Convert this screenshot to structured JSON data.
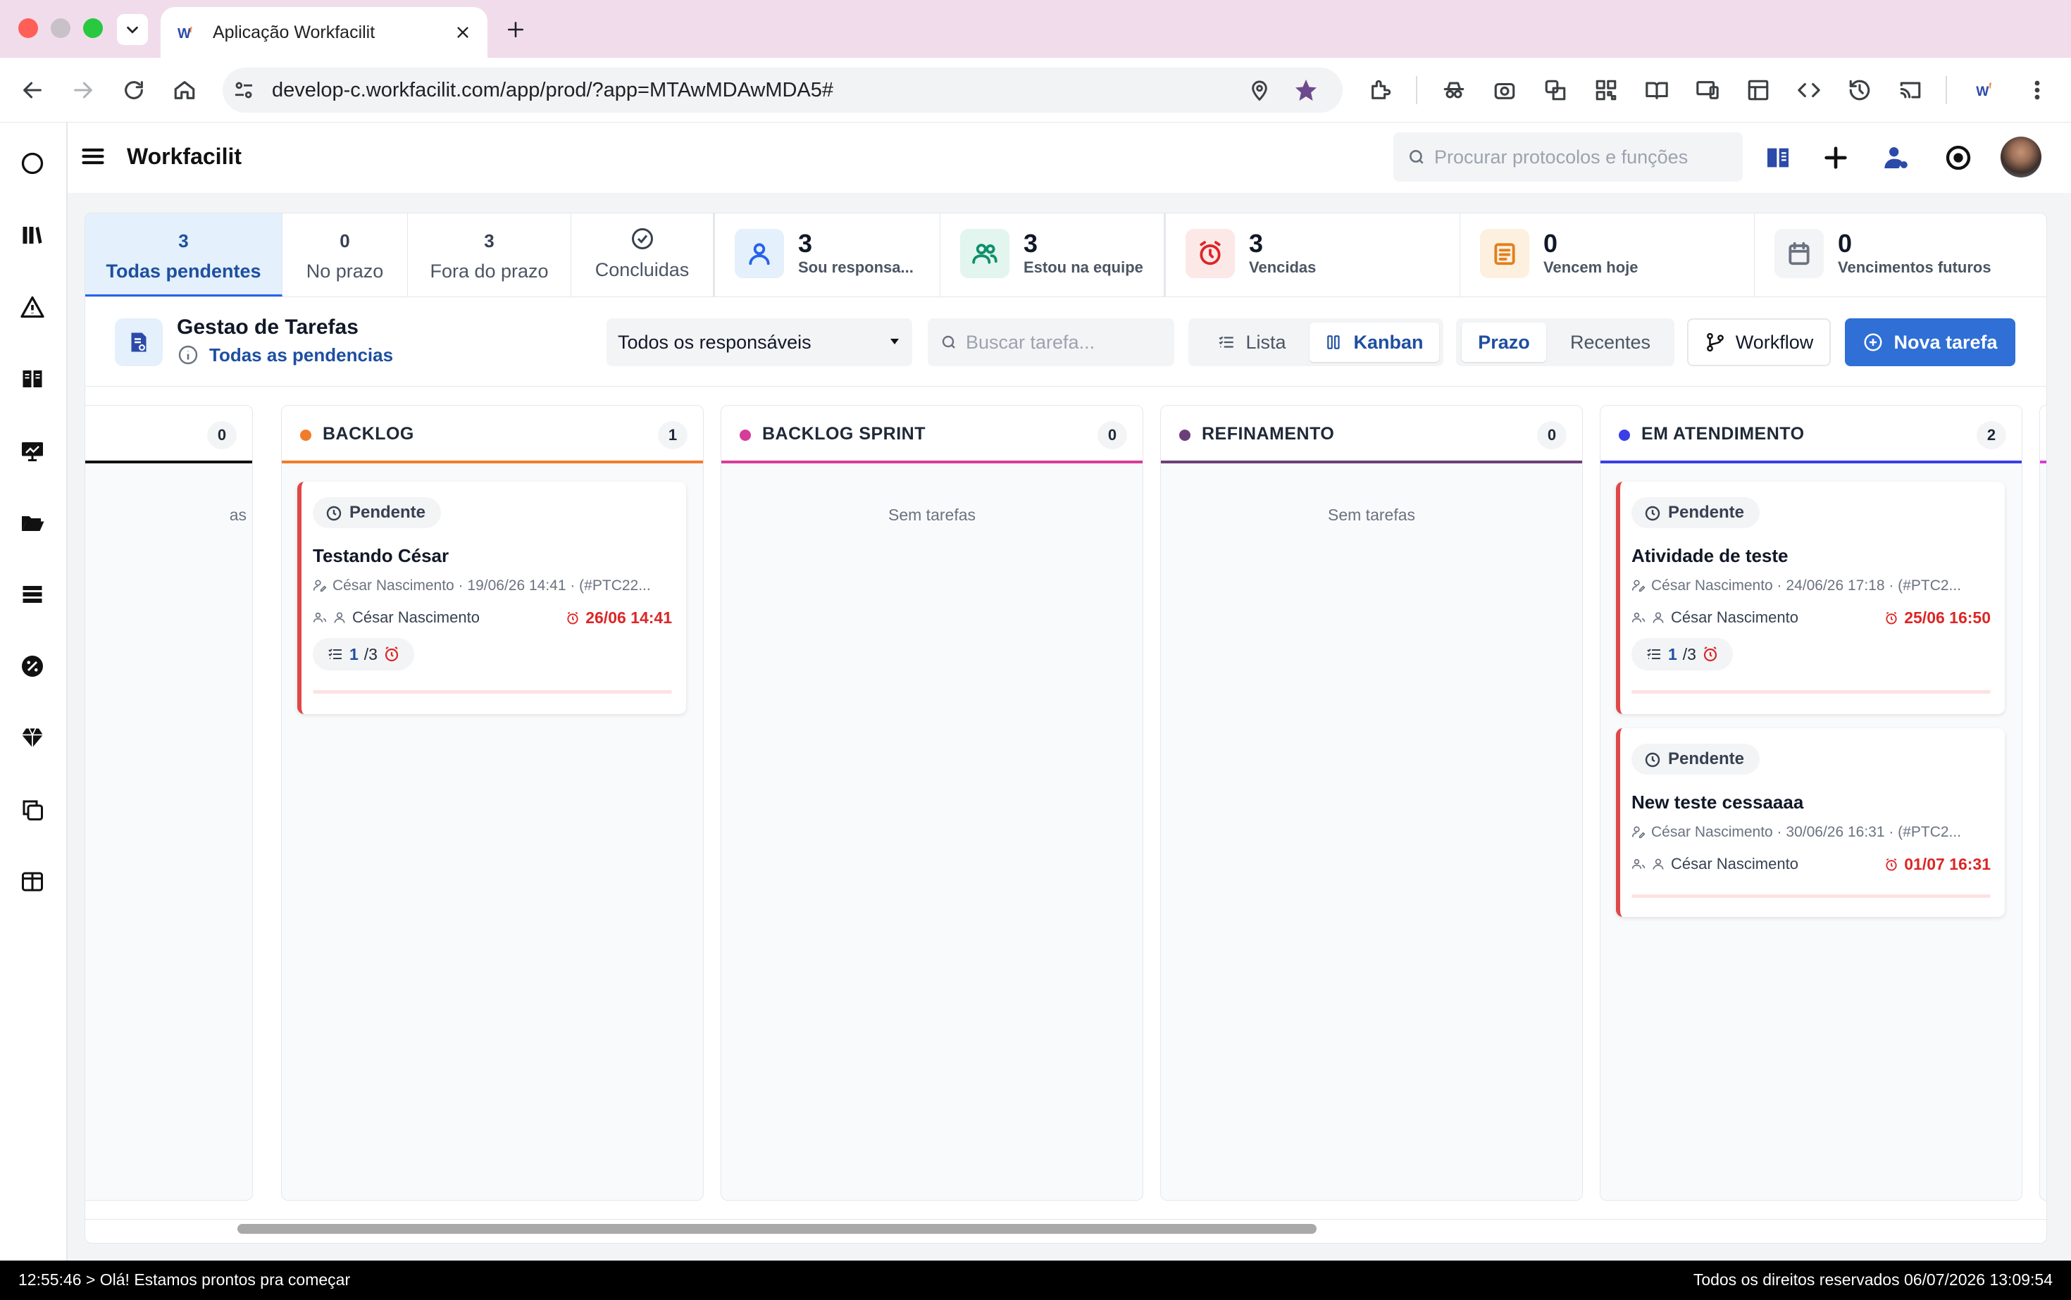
{
  "browser": {
    "tab_title": "Aplicação Workfacilit",
    "url": "develop-c.workfacilit.com/app/prod/?app=MTAwMDAwMDA5#"
  },
  "app": {
    "name": "Workfacilit",
    "search_placeholder": "Procurar protocolos e funções"
  },
  "stats": {
    "todas": {
      "count": "3",
      "label": "Todas pendentes"
    },
    "prazo": {
      "count": "0",
      "label": "No prazo"
    },
    "fora": {
      "count": "3",
      "label": "Fora do prazo"
    },
    "concluidas": {
      "label": "Concluidas"
    },
    "sou": {
      "count": "3",
      "label": "Sou responsa..."
    },
    "equipe": {
      "count": "3",
      "label": "Estou na equipe"
    },
    "vencidas": {
      "count": "3",
      "label": "Vencidas"
    },
    "hoje": {
      "count": "0",
      "label": "Vencem hoje"
    },
    "futuros": {
      "count": "0",
      "label": "Vencimentos futuros"
    }
  },
  "toolbar": {
    "title": "Gestao de Tarefas",
    "subtitle": "Todas as pendencias",
    "responsaveis": "Todos os responsáveis",
    "buscar_placeholder": "Buscar tarefa...",
    "lista": "Lista",
    "kanban": "Kanban",
    "prazo": "Prazo",
    "recentes": "Recentes",
    "workflow": "Workflow",
    "nova": "Nova tarefa"
  },
  "columns": [
    {
      "title": "",
      "count": "0",
      "empty_partial": "as"
    },
    {
      "title": "BACKLOG",
      "count": "1",
      "color": "#f07c2b"
    },
    {
      "title": "BACKLOG SPRINT",
      "count": "0",
      "color": "#d63c9a",
      "empty": "Sem tarefas"
    },
    {
      "title": "REFINAMENTO",
      "count": "0",
      "color": "#6b3f7a",
      "empty": "Sem tarefas"
    },
    {
      "title": "EM ATENDIMENTO",
      "count": "2",
      "color": "#3b3ee6"
    }
  ],
  "cards": [
    {
      "status": "Pendente",
      "title": "Testando César",
      "meta": "César Nascimento · 19/06/26 14:41 · (#PTC22...",
      "resp": "César Nascimento",
      "due": "26/06 14:41",
      "sub_done": "1",
      "sub_total": "/3"
    },
    {
      "status": "Pendente",
      "title": "Atividade de teste",
      "meta": "César Nascimento · 24/06/26 17:18 · (#PTC2...",
      "resp": "César Nascimento",
      "due": "25/06 16:50",
      "sub_done": "1",
      "sub_total": "/3"
    },
    {
      "status": "Pendente",
      "title": "New teste cessaaaa",
      "meta": "César Nascimento · 30/06/26 16:31 · (#PTC2...",
      "resp": "César Nascimento",
      "due": "01/07 16:31"
    }
  ],
  "statusbar": {
    "left": "12:55:46 > Olá! Estamos prontos pra começar",
    "right": "Todos os direitos reservados 06/07/2026 13:09:54"
  }
}
